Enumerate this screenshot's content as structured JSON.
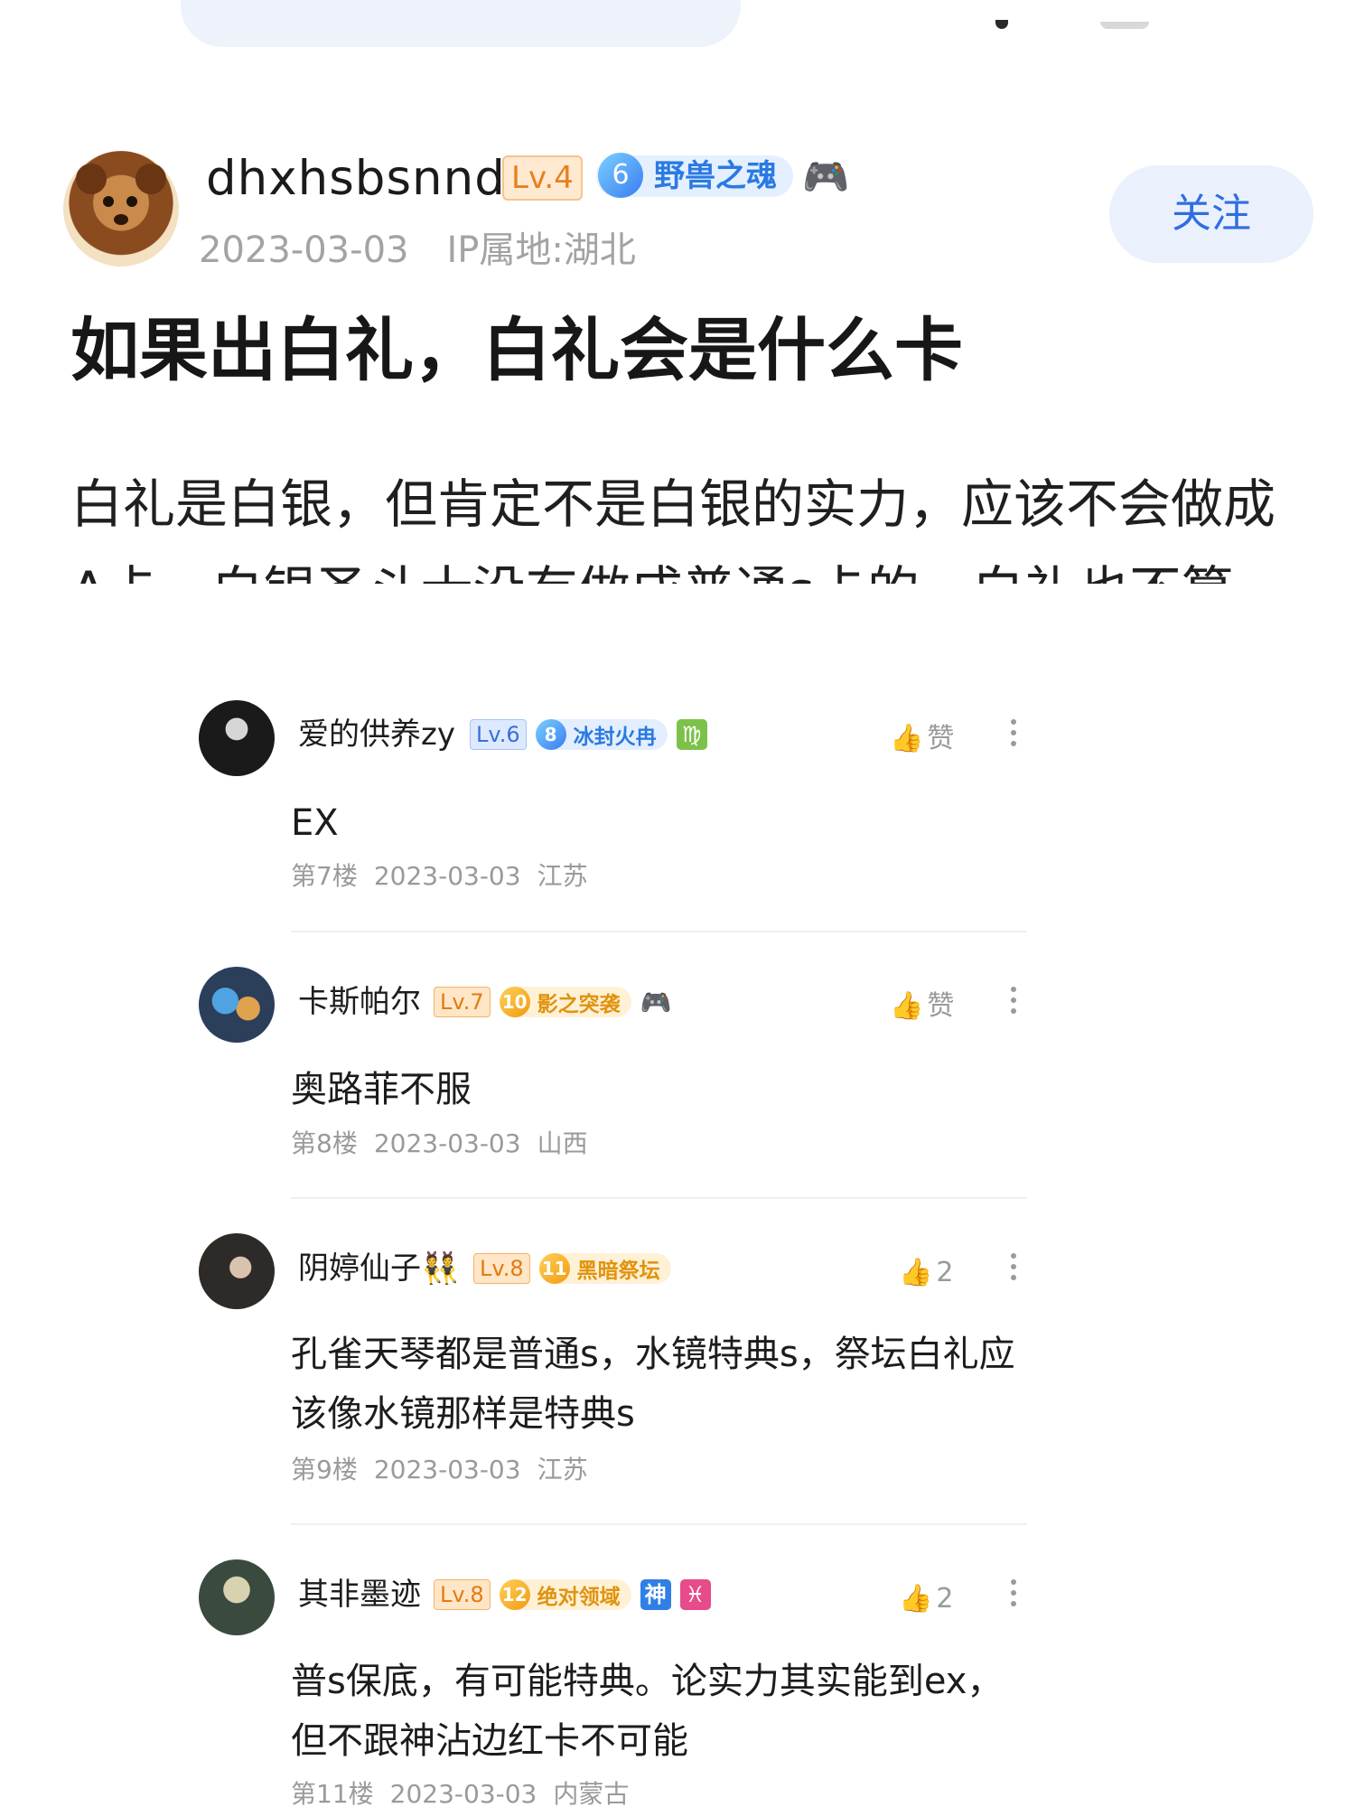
{
  "post": {
    "author": {
      "name": "dhxhsbsnnd",
      "level": "Lv.4",
      "medal_level": "6",
      "medal_name": "野兽之魂",
      "date": "2023-03-03",
      "ip": "IP属地:湖北"
    },
    "follow_label": "关注",
    "title": "如果出白礼，白礼会是什么卡",
    "body_line1": "白礼是白银，但肯定不是白银的实力，应该不会做成",
    "body_line2": "A卡，白银圣斗士没有做成普通s卡的，白礼也不算"
  },
  "comments": [
    {
      "name": "爱的供养zy",
      "level": "Lv.6",
      "medal_level": "8",
      "medal_name": "冰封火冉",
      "extra_icon": "♍",
      "like_label": "赞",
      "text": "EX",
      "floor": "第7楼",
      "date": "2023-03-03",
      "location": "江苏"
    },
    {
      "name": "卡斯帕尔",
      "level": "Lv.7",
      "medal_level": "10",
      "medal_name": "影之突袭",
      "like_label": "赞",
      "text": "奥路菲不服",
      "floor": "第8楼",
      "date": "2023-03-03",
      "location": "山西"
    },
    {
      "name": "阴婷仙子👯",
      "level": "Lv.8",
      "medal_level": "11",
      "medal_name": "黑暗祭坛",
      "like_count": "2",
      "text_line1": "孔雀天琴都是普通s，水镜特典s，祭坛白礼应",
      "text_line2": "该像水镜那样是特典s",
      "floor": "第9楼",
      "date": "2023-03-03",
      "location": "江苏"
    },
    {
      "name": "其非墨迹",
      "level": "Lv.8",
      "medal_level": "12",
      "medal_name": "绝对领域",
      "icon_a": "神",
      "icon_b": "♓",
      "like_count": "2",
      "text_line1": "普s保底，有可能特典。论实力其实能到ex，",
      "text_line2": "但不跟神沾边红卡不可能",
      "floor": "第11楼",
      "date": "2023-03-03",
      "location": "内蒙古"
    }
  ],
  "colors": {
    "accent_blue": "#2f6ee0",
    "level_orange": "#e5811f",
    "meta_gray": "#9a9a9a"
  }
}
